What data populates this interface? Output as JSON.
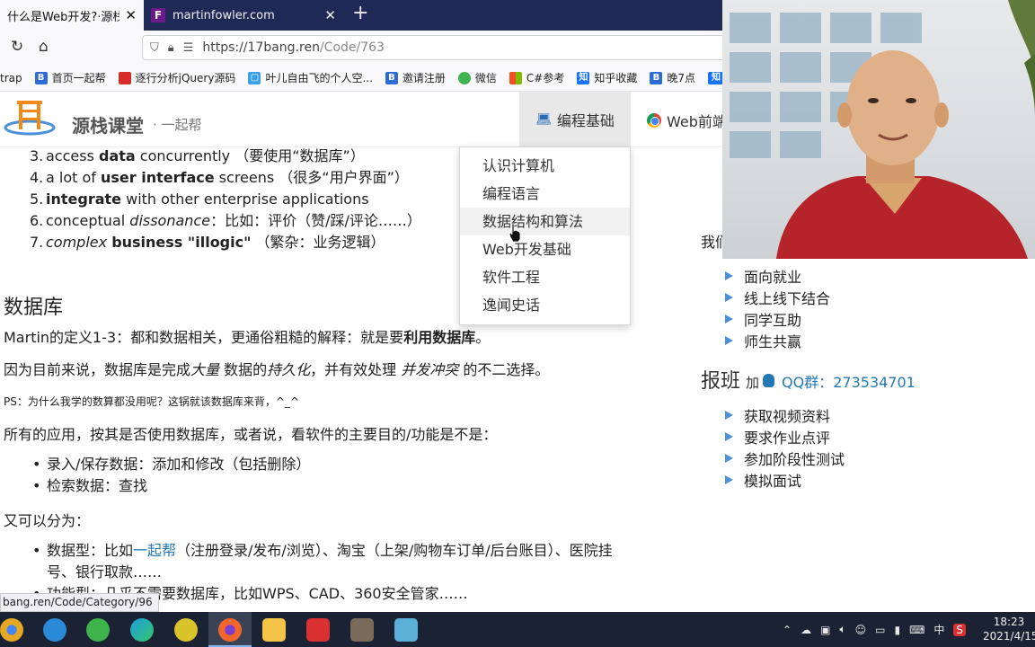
{
  "browser": {
    "tabs": [
      {
        "title": "什么是Web开发?·源栈",
        "close": "✕",
        "active": true
      },
      {
        "title": "martinfowler.com",
        "favicon": "F",
        "close": "✕",
        "active": false
      }
    ],
    "new_tab": "+",
    "url": {
      "host": "https://17bang.ren",
      "path": "/Code/763"
    },
    "bookmarks": [
      {
        "label": "trap",
        "icon": "none"
      },
      {
        "label": "首页一起帮",
        "icon": "b-logo-icon",
        "color": "#2d6bd6"
      },
      {
        "label": "逐行分析jQuery源码",
        "icon": "red-book-icon",
        "color": "#d62b2b"
      },
      {
        "label": "叶儿自由飞的个人空...",
        "icon": "bilibili-icon",
        "color": "#3aa0e6"
      },
      {
        "label": "邀请注册",
        "icon": "b-logo-icon",
        "color": "#2d6bd6"
      },
      {
        "label": "微信",
        "icon": "wechat-icon",
        "color": "#3fb34f"
      },
      {
        "label": "C#参考",
        "icon": "windows-icon",
        "color": "#f25022"
      },
      {
        "label": "知乎收藏",
        "icon": "zhihu-icon",
        "color": "#1772f6"
      },
      {
        "label": "晚7点",
        "icon": "b-logo-icon",
        "color": "#2d6bd6"
      },
      {
        "label": "知",
        "icon": "zhihu-icon",
        "color": "#1772f6"
      }
    ]
  },
  "site": {
    "brand": "源栈课堂",
    "tagline": "· 一起帮",
    "menu": [
      {
        "label": "编程基础",
        "icon": "laptop-icon",
        "active": true
      },
      {
        "label": "Web前端",
        "icon": "chrome-icon",
        "active": false
      }
    ],
    "dropdown": [
      "认识计算机",
      "编程语言",
      "数据结构和算法",
      "Web开发基础",
      "软件工程",
      "逸闻史话"
    ]
  },
  "article": {
    "list": [
      {
        "num": "3.",
        "parts": [
          [
            "access ",
            ""
          ],
          [
            "data",
            "b"
          ],
          [
            " concurrently   （要使用“数据库”）",
            ""
          ]
        ]
      },
      {
        "num": "4.",
        "parts": [
          [
            "a lot of ",
            ""
          ],
          [
            "user interface",
            "b"
          ],
          [
            " screens      （很多“用户界面”）",
            ""
          ]
        ]
      },
      {
        "num": "5.",
        "parts": [
          [
            "integrate",
            "b"
          ],
          [
            " with other enterprise applications",
            ""
          ]
        ]
      },
      {
        "num": "6.",
        "parts": [
          [
            "conceptual ",
            ""
          ],
          [
            "dissonance",
            "i"
          ],
          [
            "：比如：评价（赞/踩/评论……）",
            ""
          ]
        ]
      },
      {
        "num": "7.",
        "parts": [
          [
            "complex",
            "i"
          ],
          [
            " ",
            ""
          ],
          [
            "business \"illogic\"",
            "b"
          ],
          [
            "     （繁杂：业务逻辑）",
            ""
          ]
        ]
      }
    ],
    "section_title": "数据库",
    "p1": {
      "prefix": "Martin的定义1-3：都和数据相关，更通俗粗糙的解释：就是要",
      "bold": "利用数据库",
      "suffix": "。"
    },
    "p2": {
      "a": "因为目前来说，数据库是完成",
      "i1": "大量",
      "b": " 数据的",
      "i2": "持久化",
      "c": "，并有效处理 ",
      "i3": "并发冲突",
      "d": " 的不二选择。"
    },
    "ps": "PS：为什么我学的数算都没用呢？这锅就该数据库来背，^_^",
    "p3": "所有的应用，按其是否使用数据库，或者说，看软件的主要目的/功能是不是：",
    "bullets1": [
      "录入/保存数据：添加和修改（包括删除）",
      "检索数据：查找"
    ],
    "p4": "又可以分为：",
    "bullet2": {
      "prefix": "数据型：比如",
      "link": "一起帮",
      "suffix": "（注册登录/发布/浏览）、淘宝（上架/购物车订单/后台账目）、医院挂",
      "line2": "号、银行取款……"
    },
    "bullet3": "功能型：几乎不需要数据库，比如WPS、CAD、360安全管家……"
  },
  "sidebar": {
    "we_prefix": "我们",
    "features": [
      "面向就业",
      "线上线下结合",
      "同学互助",
      "师生共赢"
    ],
    "enroll_title": "报班",
    "enroll_join": "加",
    "qq": "QQ群：273534701",
    "services": [
      "获取视频资料",
      "要求作业点评",
      "参加阶段性测试",
      "模拟面试"
    ]
  },
  "status_link": "bang.ren/Code/Category/96",
  "taskbar": {
    "apps": [
      {
        "name": "chrome-icon",
        "color": "#e5a823"
      },
      {
        "name": "edge-dev-icon",
        "color": "#2a8ad8"
      },
      {
        "name": "360-browser-icon",
        "color": "#3db34a"
      },
      {
        "name": "edge-icon",
        "color": "#1d9fe0"
      },
      {
        "name": "fiddler-icon",
        "color": "#d9c32b"
      },
      {
        "name": "firefox-icon",
        "color": "#f2662c"
      },
      {
        "name": "file-explorer-icon",
        "color": "#f3c447"
      },
      {
        "name": "wps-icon",
        "color": "#d93131"
      },
      {
        "name": "avatar-app-icon",
        "color": "#7a6a5a"
      },
      {
        "name": "screen-recorder-icon",
        "color": "#5bb0d8"
      }
    ],
    "ime": "中",
    "time": "18:23",
    "date": "2021/4/15"
  }
}
